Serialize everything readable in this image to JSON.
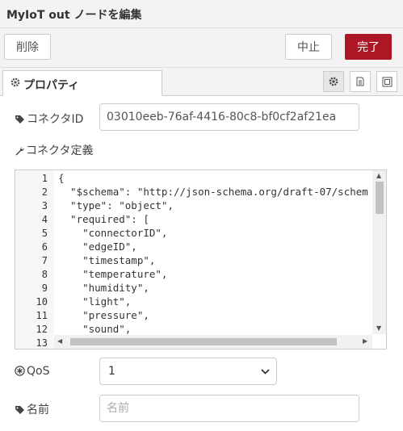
{
  "window": {
    "title": "MyIoT out ノードを編集"
  },
  "toolbar": {
    "delete_label": "削除",
    "cancel_label": "中止",
    "done_label": "完了"
  },
  "tabs": [
    {
      "label": "プロパティ",
      "icon": "gear-icon"
    }
  ],
  "tab_buttons": [
    "gear-icon",
    "description-icon",
    "appearance-icon"
  ],
  "connector_id": {
    "label": "コネクタID",
    "value": "03010eeb-76af-4416-80c8-bf0cf2af21ea"
  },
  "connector_def": {
    "label": "コネクタ定義",
    "line_numbers": [
      "1",
      "2",
      "3",
      "4",
      "5",
      "6",
      "7",
      "8",
      "9",
      "10",
      "11",
      "12",
      "13"
    ],
    "lines": [
      "{",
      "  \"$schema\": \"http://json-schema.org/draft-07/schem",
      "  \"type\": \"object\",",
      "  \"required\": [",
      "    \"connectorID\",",
      "    \"edgeID\",",
      "    \"timestamp\",",
      "    \"temperature\",",
      "    \"humidity\",",
      "    \"light\",",
      "    \"pressure\",",
      "    \"sound\",",
      ""
    ]
  },
  "qos": {
    "label": "QoS",
    "value": "1",
    "options": [
      "1"
    ]
  },
  "name": {
    "label": "名前",
    "placeholder": "名前"
  },
  "colors": {
    "accent": "#ad1625",
    "panel": "#f3f3f3",
    "border": "#cccccc"
  }
}
